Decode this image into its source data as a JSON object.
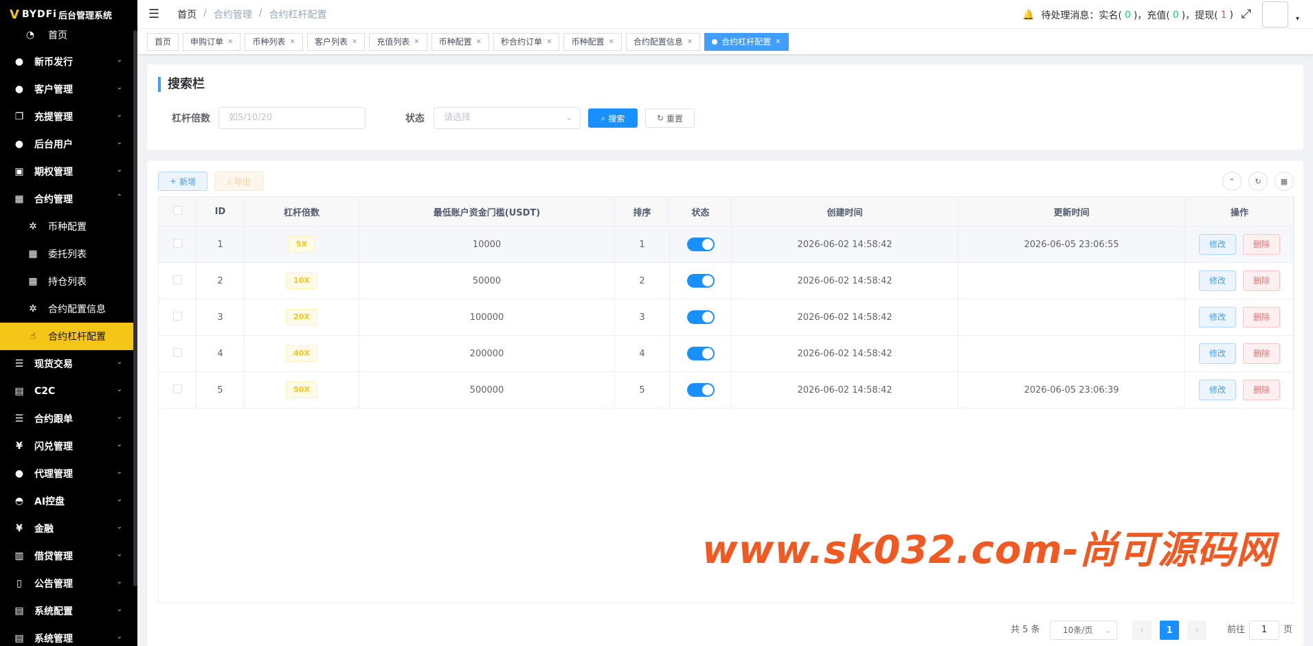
{
  "app": {
    "logo_mark": "V",
    "logo_text": "BYDFi",
    "logo_suffix": "后台管理系统"
  },
  "sidebar": {
    "items": [
      {
        "label": "首页",
        "icon": "dashboard-icon"
      },
      {
        "label": "新币发行",
        "icon": "user-icon"
      },
      {
        "label": "客户管理",
        "icon": "user-icon"
      },
      {
        "label": "充提管理",
        "icon": "copy-icon"
      },
      {
        "label": "后台用户",
        "icon": "users-icon"
      },
      {
        "label": "期权管理",
        "icon": "monitor-icon"
      },
      {
        "label": "合约管理",
        "icon": "table-icon"
      },
      {
        "label": "币种配置",
        "icon": "gear-icon"
      },
      {
        "label": "委托列表",
        "icon": "table-icon"
      },
      {
        "label": "持仓列表",
        "icon": "table-icon"
      },
      {
        "label": "合约配置信息",
        "icon": "gear-icon"
      },
      {
        "label": "合约杠杆配置",
        "icon": "hand-icon"
      },
      {
        "label": "现货交易",
        "icon": "list-icon"
      },
      {
        "label": "C2C",
        "icon": "document-icon"
      },
      {
        "label": "合约跟单",
        "icon": "list-icon"
      },
      {
        "label": "闪兑管理",
        "icon": "yen-icon"
      },
      {
        "label": "代理管理",
        "icon": "user-icon"
      },
      {
        "label": "AI控盘",
        "icon": "robot-icon"
      },
      {
        "label": "金融",
        "icon": "yen-icon"
      },
      {
        "label": "借贷管理",
        "icon": "book-icon"
      },
      {
        "label": "公告管理",
        "icon": "book-icon"
      },
      {
        "label": "系统配置",
        "icon": "document-icon"
      },
      {
        "label": "系统管理",
        "icon": "document-icon"
      }
    ]
  },
  "header": {
    "breadcrumb": [
      "首页",
      "合约管理",
      "合约杠杆配置"
    ],
    "notice_prefix": "待处理消息：实名(",
    "notice_realname": "0",
    "notice_mid1": ")，充值(",
    "notice_deposit": "0",
    "notice_mid2": ")，提现(",
    "notice_withdraw": "1",
    "notice_end": ")"
  },
  "tabs": [
    "首页",
    "申购订单",
    "币种列表",
    "客户列表",
    "充值列表",
    "币种配置",
    "秒合约订单",
    "币种配置",
    "合约配置信息",
    "合约杠杆配置"
  ],
  "search": {
    "title": "搜索栏",
    "leverage_label": "杠杆倍数",
    "leverage_placeholder": "如5/10/20",
    "status_label": "状态",
    "status_placeholder": "请选择",
    "search_button": "搜索",
    "reset_button": "重置"
  },
  "toolbar": {
    "add_label": "新增",
    "export_label": "导出"
  },
  "table": {
    "headers": [
      "ID",
      "杠杆倍数",
      "最低账户资金门槛(USDT)",
      "排序",
      "状态",
      "创建时间",
      "更新时间",
      "操作"
    ],
    "rows": [
      {
        "id": "1",
        "leverage": "5X",
        "min_funds": "10000",
        "sort": "1",
        "enabled": true,
        "created": "2026-06-02 14:58:42",
        "updated": "2026-06-05 23:06:55"
      },
      {
        "id": "2",
        "leverage": "10X",
        "min_funds": "50000",
        "sort": "2",
        "enabled": true,
        "created": "2026-06-02 14:58:42",
        "updated": ""
      },
      {
        "id": "3",
        "leverage": "20X",
        "min_funds": "100000",
        "sort": "3",
        "enabled": true,
        "created": "2026-06-02 14:58:42",
        "updated": ""
      },
      {
        "id": "4",
        "leverage": "40X",
        "min_funds": "200000",
        "sort": "4",
        "enabled": true,
        "created": "2026-06-02 14:58:42",
        "updated": ""
      },
      {
        "id": "5",
        "leverage": "50X",
        "min_funds": "500000",
        "sort": "5",
        "enabled": true,
        "created": "2026-06-02 14:58:42",
        "updated": "2026-06-05 23:06:39"
      }
    ],
    "edit_label": "修改",
    "delete_label": "删除"
  },
  "watermark": "www.sk032.com-尚可源码网",
  "pagination": {
    "total": "共 5 条",
    "page_size": "10条/页",
    "current": "1",
    "goto_label": "前往",
    "goto_value": "1",
    "page_suffix": "页"
  },
  "colors": {
    "accent": "#1890ff",
    "sidebar_active": "#f5c518",
    "watermark": "#f05a22"
  }
}
